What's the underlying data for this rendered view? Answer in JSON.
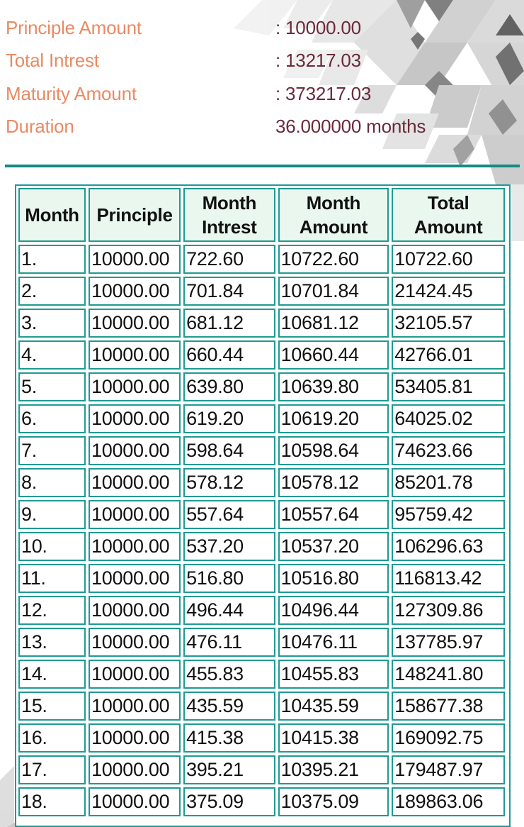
{
  "summary": {
    "principle_label": "Principle Amount",
    "principle_value": ": 10000.00",
    "interest_label": "Total Intrest",
    "interest_value": ": 13217.03",
    "maturity_label": "Maturity Amount",
    "maturity_value": ": 373217.03",
    "duration_label": "Duration",
    "duration_value": "36.000000 months"
  },
  "colors": {
    "label": "#e98a62",
    "value": "#6a2a3a",
    "accent": "#138a85",
    "table_border": "#1f9a92",
    "header_bg": "#e9f7ef"
  },
  "table": {
    "headers": [
      "Month",
      "Principle",
      "Month Intrest",
      "Month Amount",
      "Total Amount"
    ],
    "rows": [
      [
        "1.",
        "10000.00",
        "722.60",
        "10722.60",
        "10722.60"
      ],
      [
        "2.",
        "10000.00",
        "701.84",
        "10701.84",
        "21424.45"
      ],
      [
        "3.",
        "10000.00",
        "681.12",
        "10681.12",
        "32105.57"
      ],
      [
        "4.",
        "10000.00",
        "660.44",
        "10660.44",
        "42766.01"
      ],
      [
        "5.",
        "10000.00",
        "639.80",
        "10639.80",
        "53405.81"
      ],
      [
        "6.",
        "10000.00",
        "619.20",
        "10619.20",
        "64025.02"
      ],
      [
        "7.",
        "10000.00",
        "598.64",
        "10598.64",
        "74623.66"
      ],
      [
        "8.",
        "10000.00",
        "578.12",
        "10578.12",
        "85201.78"
      ],
      [
        "9.",
        "10000.00",
        "557.64",
        "10557.64",
        "95759.42"
      ],
      [
        "10.",
        "10000.00",
        "537.20",
        "10537.20",
        "106296.63"
      ],
      [
        "11.",
        "10000.00",
        "516.80",
        "10516.80",
        "116813.42"
      ],
      [
        "12.",
        "10000.00",
        "496.44",
        "10496.44",
        "127309.86"
      ],
      [
        "13.",
        "10000.00",
        "476.11",
        "10476.11",
        "137785.97"
      ],
      [
        "14.",
        "10000.00",
        "455.83",
        "10455.83",
        "148241.80"
      ],
      [
        "15.",
        "10000.00",
        "435.59",
        "10435.59",
        "158677.38"
      ],
      [
        "16.",
        "10000.00",
        "415.38",
        "10415.38",
        "169092.75"
      ],
      [
        "17.",
        "10000.00",
        "395.21",
        "10395.21",
        "179487.97"
      ],
      [
        "18.",
        "10000.00",
        "375.09",
        "10375.09",
        "189863.06"
      ]
    ]
  }
}
